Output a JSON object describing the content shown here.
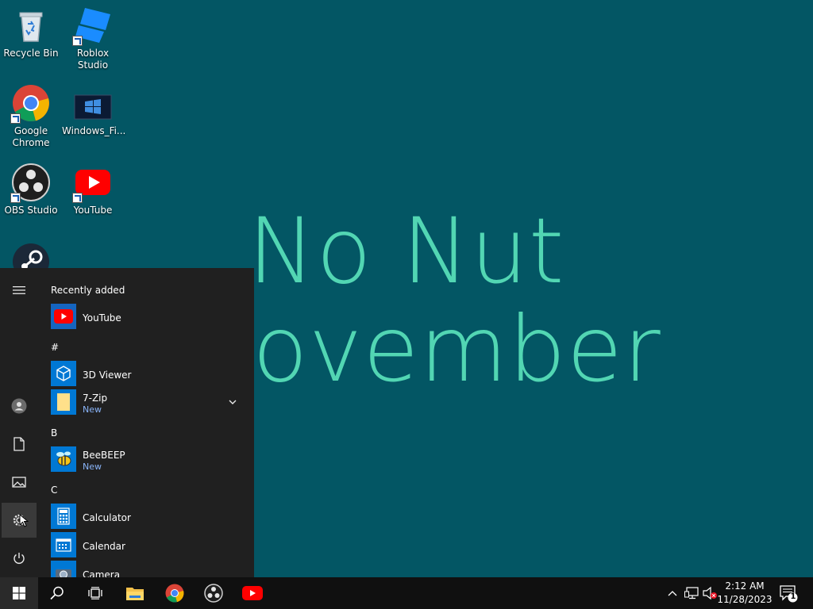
{
  "wallpaper": {
    "line1": "No Nut",
    "line2": "ovember"
  },
  "desktop": {
    "icons": [
      {
        "label": "Recycle Bin"
      },
      {
        "label": "Roblox Studio"
      },
      {
        "label": "Google Chrome"
      },
      {
        "label": "Windows_Fi..."
      },
      {
        "label": "OBS Studio"
      },
      {
        "label": "YouTube"
      }
    ]
  },
  "start_menu": {
    "recently_added_header": "Recently added",
    "sections": [
      "#",
      "B",
      "C"
    ],
    "apps": [
      {
        "name": "YouTube",
        "badge": ""
      },
      {
        "name": "3D Viewer",
        "badge": ""
      },
      {
        "name": "7-Zip",
        "badge": "New"
      },
      {
        "name": "BeeBEEP",
        "badge": "New"
      },
      {
        "name": "Calculator",
        "badge": ""
      },
      {
        "name": "Calendar",
        "badge": ""
      },
      {
        "name": "Camera",
        "badge": ""
      }
    ]
  },
  "taskbar": {
    "time": "2:12 AM",
    "date": "11/28/2023",
    "notification_count": "1"
  },
  "colors": {
    "desktop_bg": "#035664",
    "wallpaper_text": "#52d6b3",
    "start_bg": "#202020",
    "taskbar_bg": "#101010",
    "accent": "#0078d4"
  }
}
